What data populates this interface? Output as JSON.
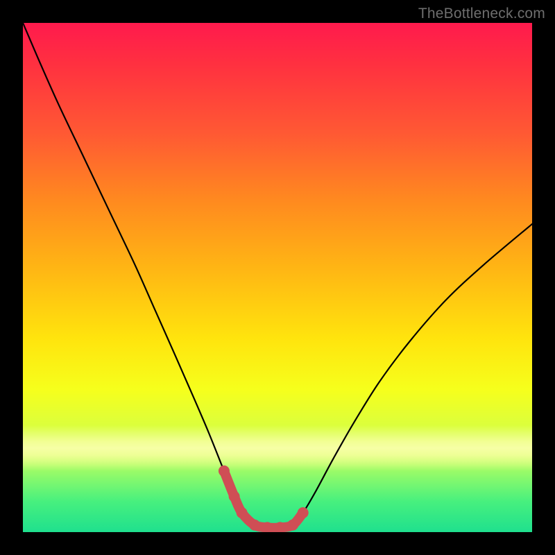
{
  "watermark": {
    "text": "TheBottleneck.com"
  },
  "colors": {
    "background": "#000000",
    "curve_stroke": "#000000",
    "highlight_stroke": "#cf4e55",
    "highlight_fill": "#cf4e55"
  },
  "chart_data": {
    "type": "line",
    "title": "",
    "xlabel": "",
    "ylabel": "",
    "xlim": [
      0,
      100
    ],
    "ylim": [
      0,
      100
    ],
    "grid": false,
    "series": [
      {
        "name": "bottleneck-curve",
        "x_percent": [
          0.0,
          3.0,
          7.0,
          12.0,
          17.0,
          22.0,
          26.0,
          30.0,
          33.5,
          36.5,
          39.5,
          41.5,
          43.0,
          45.5,
          48.0,
          50.5,
          53.0,
          55.0,
          57.5,
          61.0,
          65.0,
          70.0,
          76.0,
          83.0,
          90.5,
          100.0
        ],
        "y_percent": [
          100.0,
          93.0,
          84.0,
          73.5,
          63.0,
          52.5,
          43.5,
          34.5,
          26.5,
          19.5,
          12.0,
          7.0,
          3.8,
          1.4,
          0.9,
          0.9,
          1.4,
          3.8,
          8.0,
          14.5,
          21.5,
          29.5,
          37.5,
          45.5,
          52.5,
          60.5
        ]
      }
    ],
    "highlight_segment": {
      "description": "near-zero-bottleneck region (points shown as thick pink stroke + dots)",
      "x_percent": [
        39.5,
        41.5,
        43.0,
        45.5,
        48.0,
        50.5,
        53.0,
        55.0
      ],
      "y_percent": [
        12.0,
        7.0,
        3.8,
        1.4,
        0.9,
        0.9,
        1.4,
        3.8
      ]
    },
    "band": {
      "y_percent_center": 16.5,
      "y_percent_height": 9.0
    }
  }
}
